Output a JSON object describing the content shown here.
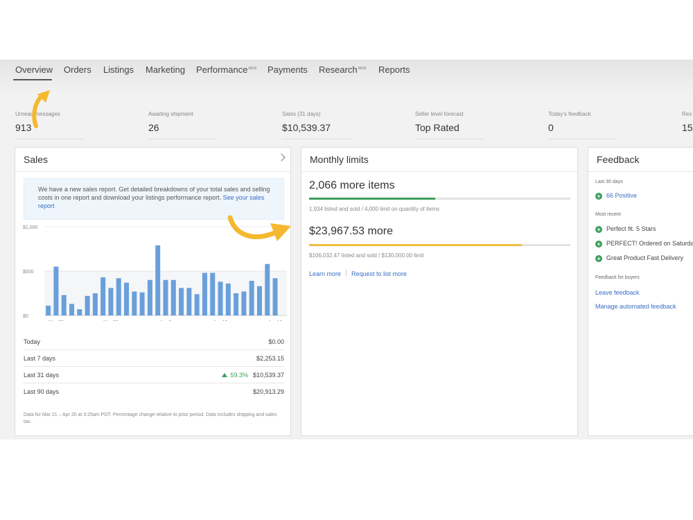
{
  "nav": {
    "tabs": [
      {
        "label": "Overview",
        "sup": ""
      },
      {
        "label": "Orders",
        "sup": ""
      },
      {
        "label": "Listings",
        "sup": ""
      },
      {
        "label": "Marketing",
        "sup": ""
      },
      {
        "label": "Performance",
        "sup": "NEW"
      },
      {
        "label": "Payments",
        "sup": ""
      },
      {
        "label": "Research",
        "sup": "NEW"
      },
      {
        "label": "Reports",
        "sup": ""
      }
    ]
  },
  "stats": [
    {
      "label": "Unread messages",
      "value": "913"
    },
    {
      "label": "Awaiting shipment",
      "value": "26"
    },
    {
      "label": "Sales (31 days)",
      "value": "$10,539.37"
    },
    {
      "label": "Seller level forecast",
      "value": "Top Rated"
    },
    {
      "label": "Today's feedback",
      "value": "0"
    },
    {
      "label": "Res",
      "value": "15"
    }
  ],
  "sales": {
    "title": "Sales",
    "info_text": "We have a new sales report. Get detailed breakdowns of your total sales and selling costs in one report and download your listings performance report. ",
    "info_link": "See your sales report",
    "summary": [
      {
        "label": "Today",
        "change": "",
        "value": "$0.00"
      },
      {
        "label": "Last 7 days",
        "change": "",
        "value": "$2,253.15"
      },
      {
        "label": "Last 31 days",
        "change": "59.3%",
        "value": "$10,539.37"
      },
      {
        "label": "Last 90 days",
        "change": "",
        "value": "$20,913.29"
      }
    ],
    "footnote": "Data for Mar 21 – Apr 20 at 3:25am PDT. Percentage change relative to prior period. Data includes shipping and sales tax."
  },
  "chart_data": {
    "type": "bar",
    "categories": [
      "Mar 21",
      "Mar 22",
      "Mar 23",
      "Mar 24",
      "Mar 25",
      "Mar 26",
      "Mar 27",
      "Mar 28",
      "Mar 29",
      "Mar 30",
      "Mar 31",
      "Apr 1",
      "Apr 2",
      "Apr 3",
      "Apr 4",
      "Apr 5",
      "Apr 6",
      "Apr 7",
      "Apr 8",
      "Apr 9",
      "Apr 10",
      "Apr 11",
      "Apr 12",
      "Apr 13",
      "Apr 14",
      "Apr 15",
      "Apr 16",
      "Apr 17",
      "Apr 18",
      "Apr 19",
      "Apr 20"
    ],
    "values": [
      110,
      550,
      230,
      130,
      70,
      220,
      250,
      430,
      310,
      420,
      370,
      270,
      260,
      400,
      790,
      400,
      400,
      310,
      310,
      240,
      480,
      480,
      380,
      360,
      250,
      270,
      390,
      330,
      580,
      420,
      0
    ],
    "x_tick_labels": [
      "Mar 22",
      "Mar 29",
      "Apr 5",
      "Apr 12",
      "Apr 19"
    ],
    "y_tick_labels": [
      "$1,000",
      "$500",
      "$0"
    ],
    "ylim": [
      0,
      1000
    ],
    "bar_color": "#6a9fdb"
  },
  "limits": {
    "title": "Monthly limits",
    "items": [
      {
        "amount": "2,066 more items",
        "detail": "1,934 listed and sold /  4,000 limit on quantity of items",
        "fraction": 0.4835,
        "color": "#3b9e5a"
      },
      {
        "amount": "$23,967.53 more",
        "detail": "$106,032.47 listed and sold /  $130,000.00 limit",
        "fraction": 0.8156,
        "color": "#f0bd3c"
      }
    ],
    "link_learn": "Learn more",
    "link_request": "Request to list more"
  },
  "feedback": {
    "title": "Feedback",
    "last30_label": "Last 30 days",
    "positive": "66 Positive",
    "recent_label": "Most recent",
    "recent": [
      "Perfect fit. 5 Stars",
      "PERFECT! Ordered on Saturday",
      "Great Product Fast Delivery"
    ],
    "buyers_label": "Feedback for buyers",
    "leave": "Leave feedback",
    "manage": "Manage automated feedback"
  },
  "colors": {
    "accent_arrow": "#f5b82e",
    "link": "#3a6ec2",
    "positive": "#3b9e5a"
  }
}
